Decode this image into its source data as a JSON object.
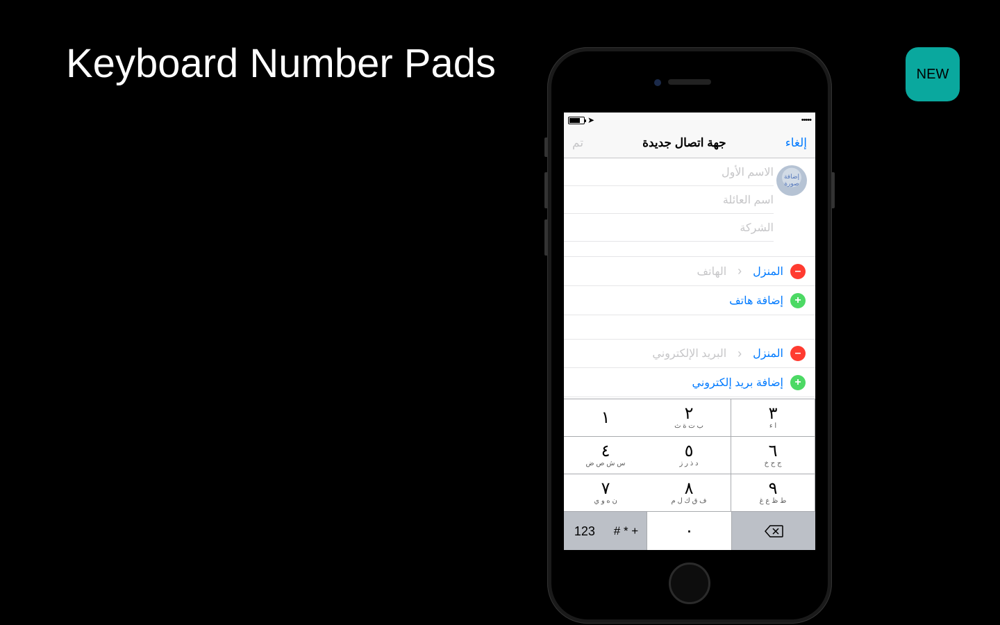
{
  "slide": {
    "title": "Keyboard Number Pads",
    "badge": "NEW"
  },
  "nav": {
    "title": "جهة اتصال جديدة",
    "cancel": "إلغاء",
    "done": "تم"
  },
  "photo_label": "إضافة صورة",
  "fields": {
    "first_name": "الاسم الأول",
    "last_name": "اسم العائلة",
    "company": "الشركة"
  },
  "phone_section": {
    "type": "المنزل",
    "placeholder": "الهاتف",
    "add": "إضافة هاتف"
  },
  "email_section": {
    "type": "المنزل",
    "placeholder": "البريد الإلكتروني",
    "add": "إضافة بريد إلكتروني"
  },
  "keypad": {
    "keys": [
      {
        "digit": "١",
        "sub": ""
      },
      {
        "digit": "٢",
        "sub": "ب ت ة ث"
      },
      {
        "digit": "٣",
        "sub": "ا ء"
      },
      {
        "digit": "٤",
        "sub": "س ش ص ض"
      },
      {
        "digit": "٥",
        "sub": "د ذ ر ز"
      },
      {
        "digit": "٦",
        "sub": "ج ح خ"
      },
      {
        "digit": "٧",
        "sub": "ن ه و ي"
      },
      {
        "digit": "٨",
        "sub": "ف ق ك ل م"
      },
      {
        "digit": "٩",
        "sub": "ط ظ ع غ"
      }
    ],
    "zero": "٠",
    "mode": "123",
    "symbols": "+ * #"
  }
}
